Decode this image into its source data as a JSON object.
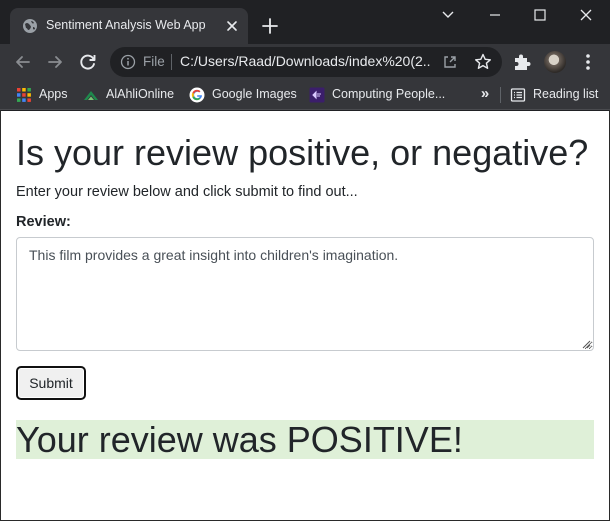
{
  "browser": {
    "tab": {
      "title": "Sentiment Analysis Web App"
    },
    "address_bar": {
      "scheme_label": "File",
      "url": "C:/Users/Raad/Downloads/index%20(2..."
    },
    "bookmarks": [
      {
        "label": "Apps",
        "icon": "apps-grid-icon"
      },
      {
        "label": "AlAhliOnline",
        "icon": "alahli-icon"
      },
      {
        "label": "Google Images",
        "icon": "google-icon"
      },
      {
        "label": "Computing People...",
        "icon": "computing-people-icon"
      }
    ],
    "reading_list": {
      "label": "Reading list"
    }
  },
  "page": {
    "heading": "Is your review positive, or negative?",
    "intro": "Enter your review below and click submit to find out...",
    "review_label": "Review:",
    "review_value": "This film provides a great insight into children's imagination.",
    "submit_label": "Submit",
    "result": "Your review was POSITIVE!"
  },
  "colors": {
    "chrome_dark": "#202124",
    "chrome_toolbar": "#35363a",
    "result_background": "#dff0d8",
    "text": "#212529"
  }
}
